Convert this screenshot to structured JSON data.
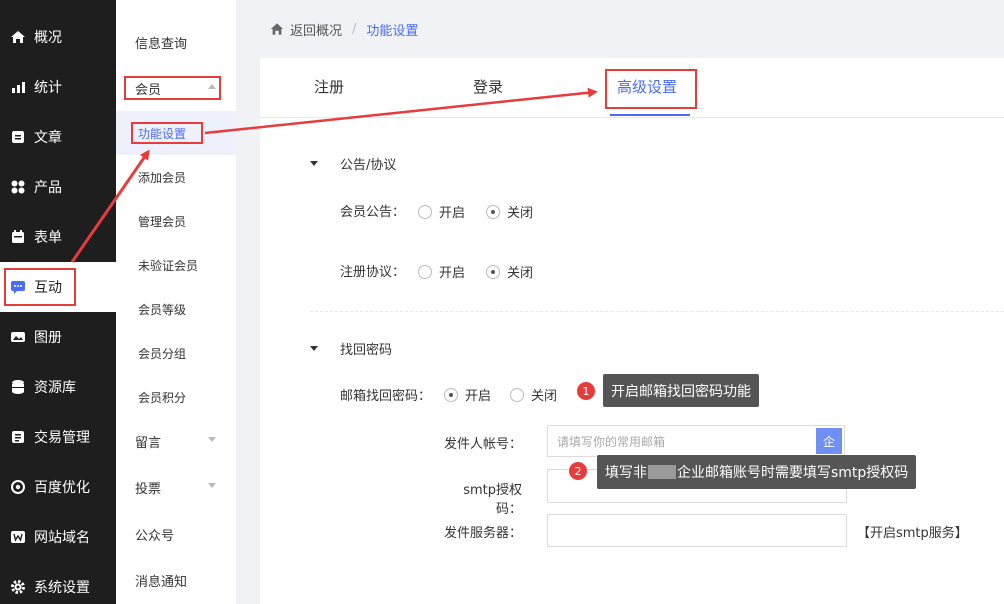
{
  "nav": {
    "items": [
      {
        "label": "概况",
        "icon": "home-icon"
      },
      {
        "label": "统计",
        "icon": "chart-icon"
      },
      {
        "label": "文章",
        "icon": "article-icon"
      },
      {
        "label": "产品",
        "icon": "grid-icon"
      },
      {
        "label": "表单",
        "icon": "calendar-icon"
      },
      {
        "label": "互动",
        "icon": "chat-icon"
      },
      {
        "label": "图册",
        "icon": "album-icon"
      },
      {
        "label": "资源库",
        "icon": "database-icon"
      },
      {
        "label": "交易管理",
        "icon": "wallet-icon"
      },
      {
        "label": "百度优化",
        "icon": "target-icon"
      },
      {
        "label": "网站域名",
        "icon": "w-icon"
      },
      {
        "label": "系统设置",
        "icon": "gear-icon"
      }
    ]
  },
  "submenu": {
    "info": "信息查询",
    "member": "会员",
    "children": [
      "功能设置",
      "添加会员",
      "管理会员",
      "未验证会员",
      "会员等级",
      "会员分组",
      "会员积分"
    ],
    "message": "留言",
    "vote": "投票",
    "official": "公众号",
    "notify": "消息通知"
  },
  "breadcrumb": {
    "back": "返回概况",
    "sep": "/",
    "current": "功能设置"
  },
  "tabs": {
    "register": "注册",
    "login": "登录",
    "advanced": "高级设置"
  },
  "notice": {
    "title": "公告/协议",
    "announce_label": "会员公告：",
    "agreement_label": "注册协议：",
    "on": "开启",
    "off": "关闭"
  },
  "recover": {
    "title": "找回密码",
    "email_label": "邮箱找回密码：",
    "on": "开启",
    "off": "关闭",
    "sender_label": "发件人帐号：",
    "sender_placeholder": "请填写你的常用邮箱",
    "sender_btn": "企",
    "smtp_label": "smtp授权码：",
    "server_label": "发件服务器：",
    "server_link": "【开启smtp服务】"
  },
  "tips": {
    "tip1_num": "1",
    "tip1": "开启邮箱找回密码功能",
    "tip2_num": "2",
    "tip2_pre": "填写非",
    "tip2_post": "企业邮箱账号时需要填写smtp授权码"
  },
  "colors": {
    "accent": "#4a6cf7",
    "annotation": "#e83b3b",
    "nav_bg": "#1e1e1e"
  }
}
